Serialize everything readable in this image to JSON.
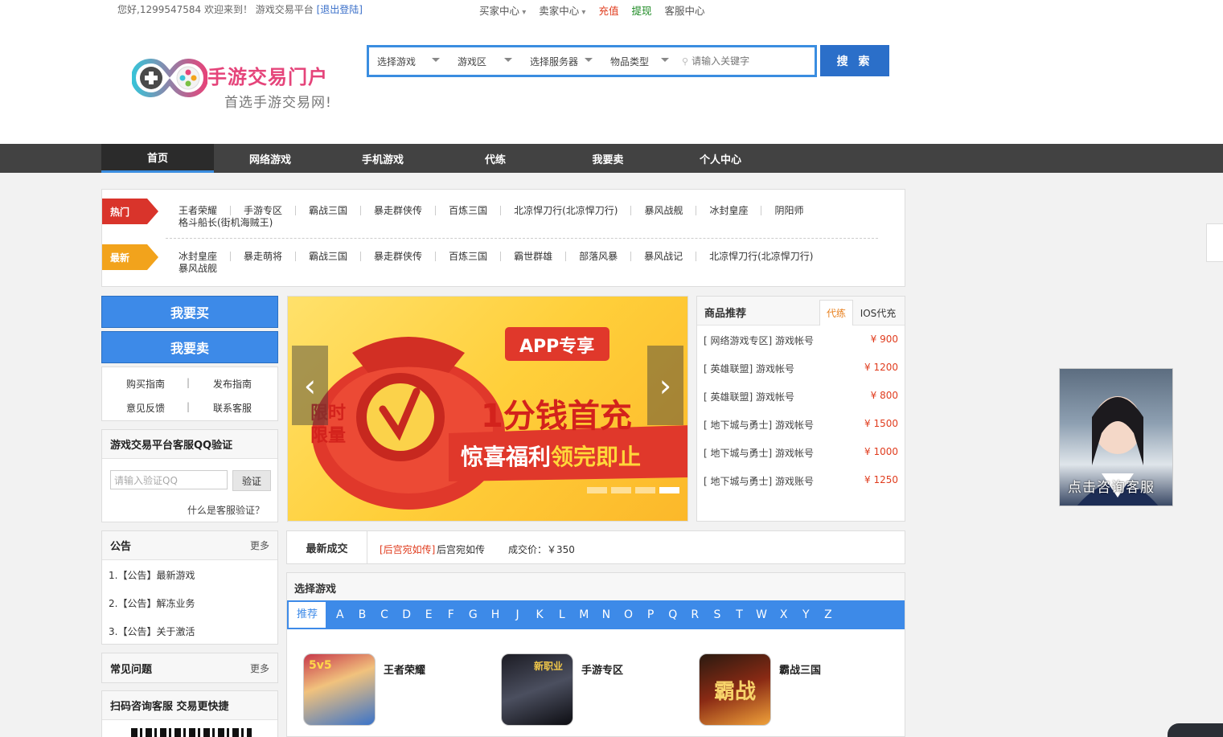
{
  "topbar": {
    "welcome": "您好,1299547584 欢迎来到！ 游戏交易平台",
    "logout": "[退出登陆]",
    "links": [
      {
        "label": "买家中心",
        "dropdown": true,
        "style": "normal"
      },
      {
        "label": "卖家中心",
        "dropdown": true,
        "style": "normal"
      },
      {
        "label": "充值",
        "dropdown": false,
        "style": "red"
      },
      {
        "label": "提现",
        "dropdown": false,
        "style": "green"
      },
      {
        "label": "客服中心",
        "dropdown": false,
        "style": "normal"
      }
    ]
  },
  "logo": {
    "title": "手游交易门户",
    "subtitle": "首选手游交易网!"
  },
  "search": {
    "selects": [
      "选择游戏",
      "游戏区",
      "选择服务器",
      "物品类型"
    ],
    "placeholder": "请输入关键字",
    "button": "搜 索"
  },
  "nav": [
    "首页",
    "网络游戏",
    "手机游戏",
    "代练",
    "我要卖",
    "个人中心"
  ],
  "hot": {
    "hot_tag": "热门",
    "new_tag": "最新",
    "hot_games": [
      "王者荣耀",
      "手游专区",
      "霸战三国",
      "暴走群侠传",
      "百炼三国",
      "北凉悍刀行(北凉悍刀行)",
      "暴风战舰",
      "冰封皇座",
      "阴阳师"
    ],
    "hot_second": "格斗船长(街机海贼王)",
    "new_games": [
      "冰封皇座",
      "暴走萌将",
      "霸战三国",
      "暴走群侠传",
      "百炼三国",
      "霸世群雄",
      "部落风暴",
      "暴风战记",
      "北凉悍刀行(北凉悍刀行)"
    ],
    "new_second": "暴风战舰"
  },
  "left": {
    "buy": "我要买",
    "sell": "我要卖",
    "guides": [
      "购买指南",
      "发布指南",
      "意见反馈",
      "联系客服"
    ],
    "qq_title": "游戏交易平台客服QQ验证",
    "qq_placeholder": "请输入验证QQ",
    "qq_button": "验证",
    "qq_help": "什么是客服验证？",
    "notice_title": "公告",
    "more": "更多",
    "notices": [
      "1.【公告】最新游戏",
      "2.【公告】解冻业务",
      "3.【公告】关于激活"
    ],
    "faq_title": "常见问题",
    "scan_title": "扫码咨询客服 交易更快捷"
  },
  "banner": {
    "badge": "APP专享",
    "headline": "1分钱首充",
    "ribbon_white": "惊喜福利",
    "ribbon_yellow": "领完即止",
    "limit_line1": "限时",
    "limit_line2": "限量",
    "slides": 4,
    "active_slide": 4
  },
  "recommend": {
    "title": "商品推荐",
    "tabs": [
      "代练",
      "IOS代充"
    ],
    "items": [
      {
        "name": "[ 网络游戏专区] 游戏帐号",
        "price": "¥ 900"
      },
      {
        "name": "[ 英雄联盟] 游戏帐号",
        "price": "¥ 1200"
      },
      {
        "name": "[ 英雄联盟] 游戏帐号",
        "price": "¥ 800"
      },
      {
        "name": "[ 地下城与勇士] 游戏帐号",
        "price": "¥ 1500"
      },
      {
        "name": "[ 地下城与勇士] 游戏帐号",
        "price": "¥ 1000"
      },
      {
        "name": "[ 地下城与勇士] 游戏账号",
        "price": "¥ 1250"
      }
    ]
  },
  "deal": {
    "title": "最新成交",
    "game_tag": "[后宫宛如传]",
    "game_name": "后宫宛如传",
    "price": "成交价：￥350"
  },
  "choose": {
    "title": "选择游戏",
    "recommend_tab": "推荐",
    "letters": [
      "A",
      "B",
      "C",
      "D",
      "E",
      "F",
      "G",
      "H",
      "J",
      "K",
      "L",
      "M",
      "N",
      "O",
      "P",
      "Q",
      "R",
      "S",
      "T",
      "W",
      "X",
      "Y",
      "Z"
    ],
    "games": [
      {
        "name": "王者荣耀",
        "icon_text": "5v5"
      },
      {
        "name": "手游专区",
        "icon_text": "新职业"
      },
      {
        "name": "霸战三国",
        "icon_text": "霸战"
      }
    ]
  },
  "service": {
    "label": "点击咨询客服"
  },
  "colors": {
    "accent": "#3d8ae8",
    "nav_bg": "#424242",
    "price": "#e03c1e",
    "hot": "#d9342b",
    "new": "#f2a31c"
  }
}
